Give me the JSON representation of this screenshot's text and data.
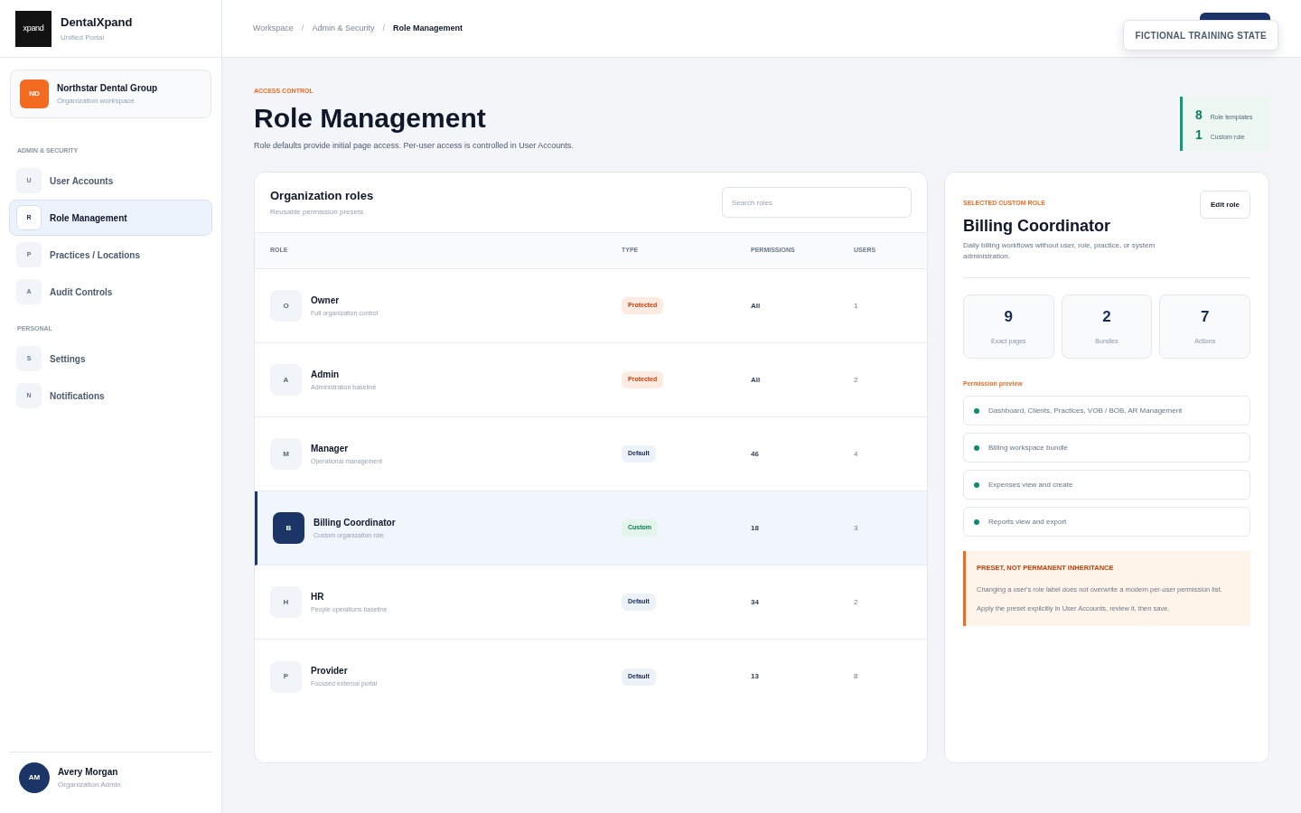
{
  "sidebar": {
    "logo": {
      "mark": "xpand",
      "name": "DentalXpand",
      "subtitle": "Unified Portal"
    },
    "organization": {
      "initials": "ND",
      "name": "Northstar Dental Group",
      "subtitle": "Organization workspace"
    },
    "sections": [
      {
        "heading": "ADMIN & SECURITY",
        "items": [
          {
            "letter": "U",
            "label": "User Accounts",
            "selected": false
          },
          {
            "letter": "R",
            "label": "Role Management",
            "selected": true
          },
          {
            "letter": "P",
            "label": "Practices / Locations",
            "selected": false
          },
          {
            "letter": "A",
            "label": "Audit Controls",
            "selected": false
          }
        ]
      },
      {
        "heading": "PERSONAL",
        "items": [
          {
            "letter": "S",
            "label": "Settings",
            "selected": false
          },
          {
            "letter": "N",
            "label": "Notifications",
            "selected": false
          }
        ]
      }
    ],
    "user": {
      "initials": "AM",
      "name": "Avery Morgan",
      "role": "Organization Admin"
    }
  },
  "header": {
    "breadcrumbs": [
      {
        "label": "Workspace",
        "current": false
      },
      {
        "label": "Admin & Security",
        "current": false
      },
      {
        "label": "Role Management",
        "current": true
      }
    ],
    "separators": [
      "/",
      "/"
    ],
    "banner": "FICTIONAL TRAINING STATE"
  },
  "page": {
    "eyebrow": "ACCESS CONTROL",
    "title": "Role Management",
    "description": "Role defaults provide initial page access. Per-user access is controlled in User Accounts.",
    "summary": [
      {
        "value": "8",
        "label": "Role templates"
      },
      {
        "value": "1",
        "label": "Custom role"
      }
    ]
  },
  "roles_table": {
    "title": "Organization roles",
    "subtitle": "Reusable permission presets",
    "search": {
      "placeholder": "Search roles"
    },
    "columns": [
      "ROLE",
      "TYPE",
      "PERMISSIONS",
      "USERS"
    ],
    "rows": [
      {
        "letter": "O",
        "name": "Owner",
        "description": "Full organization control",
        "type": {
          "label": "Protected",
          "kind": "protected"
        },
        "permissions": "All",
        "users": "1",
        "selected": false
      },
      {
        "letter": "A",
        "name": "Admin",
        "description": "Administration baseline",
        "type": {
          "label": "Protected",
          "kind": "protected"
        },
        "permissions": "All",
        "users": "2",
        "selected": false
      },
      {
        "letter": "M",
        "name": "Manager",
        "description": "Operational management",
        "type": {
          "label": "Default",
          "kind": "default"
        },
        "permissions": "46",
        "users": "4",
        "selected": false
      },
      {
        "letter": "B",
        "name": "Billing Coordinator",
        "description": "Custom organization role",
        "type": {
          "label": "Custom",
          "kind": "custom"
        },
        "permissions": "18",
        "users": "3",
        "selected": true
      },
      {
        "letter": "H",
        "name": "HR",
        "description": "People operations baseline",
        "type": {
          "label": "Default",
          "kind": "default"
        },
        "permissions": "34",
        "users": "2",
        "selected": false
      },
      {
        "letter": "P",
        "name": "Provider",
        "description": "Focused external portal",
        "type": {
          "label": "Default",
          "kind": "default"
        },
        "permissions": "13",
        "users": "8",
        "selected": false
      }
    ]
  },
  "role_detail": {
    "eyebrow": "SELECTED CUSTOM ROLE",
    "title": "Billing Coordinator",
    "description": "Daily billing workflows without user, role, practice, or system administration.",
    "edit_button": "Edit role",
    "stats": [
      {
        "value": "9",
        "label": "Exact pages"
      },
      {
        "value": "2",
        "label": "Bundles"
      },
      {
        "value": "7",
        "label": "Actions"
      }
    ],
    "preview_heading": "Permission preview",
    "permissions": [
      "Dashboard, Clients, Practices, VOB / BOB, AR Management",
      "Billing workspace bundle",
      "Expenses view and create",
      "Reports view and export"
    ],
    "notice": {
      "title": "PRESET, NOT PERMANENT INHERITANCE",
      "lines": [
        "Changing a user's role label does not overwrite a modern per-user permission list.",
        "Apply the preset explicitly in User Accounts, review it, then save."
      ]
    }
  }
}
